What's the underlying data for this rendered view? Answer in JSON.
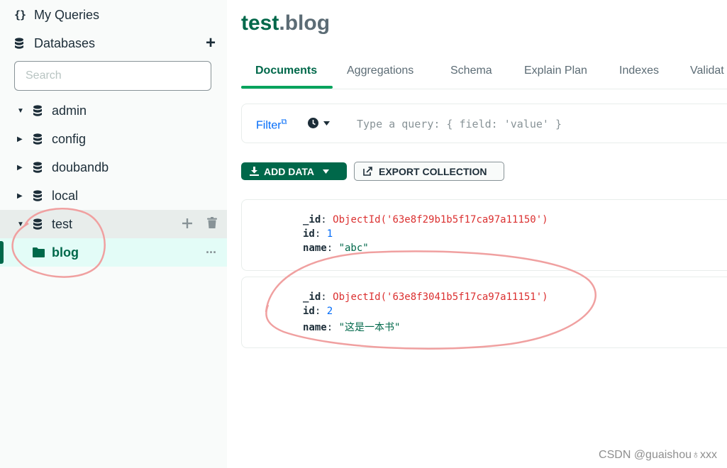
{
  "sidebar": {
    "my_queries": "My Queries",
    "databases": "Databases",
    "search_placeholder": "Search",
    "db_list": [
      "admin",
      "config",
      "doubandb",
      "local",
      "test"
    ],
    "active_collection": "blog"
  },
  "header": {
    "database": "test",
    "dot": ".",
    "collection": "blog"
  },
  "tabs": [
    "Documents",
    "Aggregations",
    "Schema",
    "Explain Plan",
    "Indexes",
    "Validat"
  ],
  "toolbar": {
    "filter_label": "Filter",
    "query_placeholder": "Type a query: { field: 'value' }",
    "add_data": "ADD DATA",
    "export": "EXPORT COLLECTION"
  },
  "documents": [
    {
      "oid": "ObjectId('63e8f29b1b5f17ca97a11150')",
      "id": "1",
      "name": "\"abc\""
    },
    {
      "oid": "ObjectId('63e8f3041b5f17ca97a11151')",
      "id": "2",
      "name": "\"这是一本书\""
    }
  ],
  "field_keys": {
    "oid": "_id",
    "id": "id",
    "name": "name"
  },
  "watermark": "CSDN @guaishou♁xxx",
  "colors": {
    "accent": "#00684a",
    "highlight": "#00a35c",
    "annotation": "#f0a0a0"
  }
}
